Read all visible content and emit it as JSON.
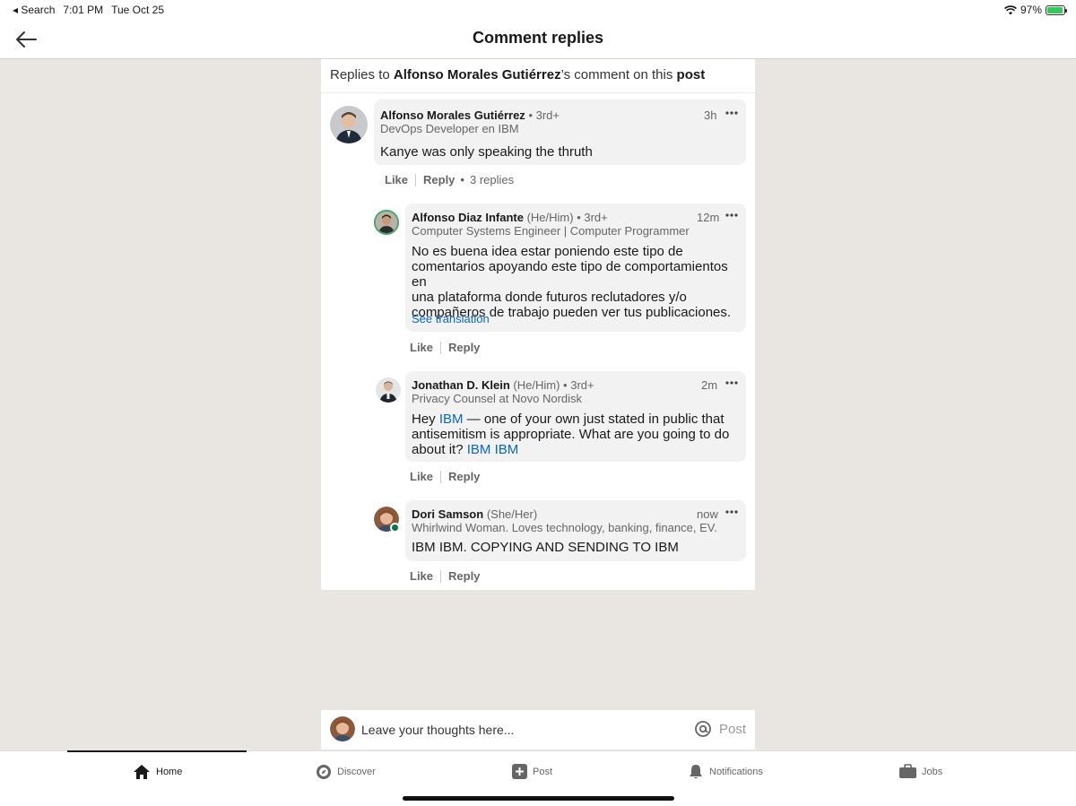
{
  "status_bar": {
    "back_app": "Search",
    "time": "7:01 PM",
    "date": "Tue Oct 25",
    "battery": "97%",
    "battery_level": 0.97
  },
  "header": {
    "title": "Comment replies"
  },
  "panel": {
    "prefix": "Replies to ",
    "author": "Alfonso Morales Gutiérrez",
    "mid": "’s comment on this ",
    "post_word": "post"
  },
  "comments": [
    {
      "name": "Alfonso Morales Gutiérrez",
      "pronouns": "",
      "degree": "• 3rd+",
      "headline": "DevOps Developer en IBM",
      "time": "3h",
      "text": "Kanye was only speaking the thruth",
      "like": "Like",
      "reply": "Reply",
      "replies": "3 replies"
    },
    {
      "name": "Alfonso Diaz Infante",
      "pronouns": "(He/Him)",
      "degree": "• 3rd+",
      "headline": "Computer Systems Engineer | Computer Programmer",
      "time": "12m",
      "lines": [
        "No es buena idea estar poniendo este tipo de",
        "comentarios apoyando este tipo de comportamientos en",
        "una plataforma donde futuros reclutadores y/o",
        "compañeros de trabajo pueden ver tus publicaciones."
      ],
      "see_translation": "See translation",
      "like": "Like",
      "reply": "Reply"
    },
    {
      "name": "Jonathan D. Klein",
      "pronouns": "(He/Him)",
      "degree": "• 3rd+",
      "headline": "Privacy Counsel at Novo Nordisk",
      "time": "2m",
      "t1": "Hey ",
      "m1": "IBM",
      "t2": " — one of your own just stated in public that",
      "line2": "antisemitism is appropriate. What are you going to do",
      "t3": "about it? ",
      "m2": "IBM",
      "m3": "IBM",
      "like": "Like",
      "reply": "Reply"
    },
    {
      "name": "Dori Samson",
      "pronouns": "(She/Her)",
      "degree": "",
      "headline": "Whirlwind Woman. Loves technology, banking, finance, EV...",
      "time": "now",
      "text": "IBM IBM. COPYING AND SENDING TO IBM",
      "like": "Like",
      "reply": "Reply"
    }
  ],
  "composer": {
    "placeholder": "Leave your thoughts here...",
    "post": "Post"
  },
  "tabs": [
    {
      "label": "Home",
      "icon": "home-icon",
      "active": true
    },
    {
      "label": "Discover",
      "icon": "compass-icon"
    },
    {
      "label": "Post",
      "icon": "plus-square-icon"
    },
    {
      "label": "Notifications",
      "icon": "bell-icon"
    },
    {
      "label": "Jobs",
      "icon": "briefcase-icon"
    }
  ],
  "colors": {
    "link": "#0a66c2",
    "background": "#e9e6e1",
    "bubble": "#f2f2f2",
    "online": "#057642"
  }
}
